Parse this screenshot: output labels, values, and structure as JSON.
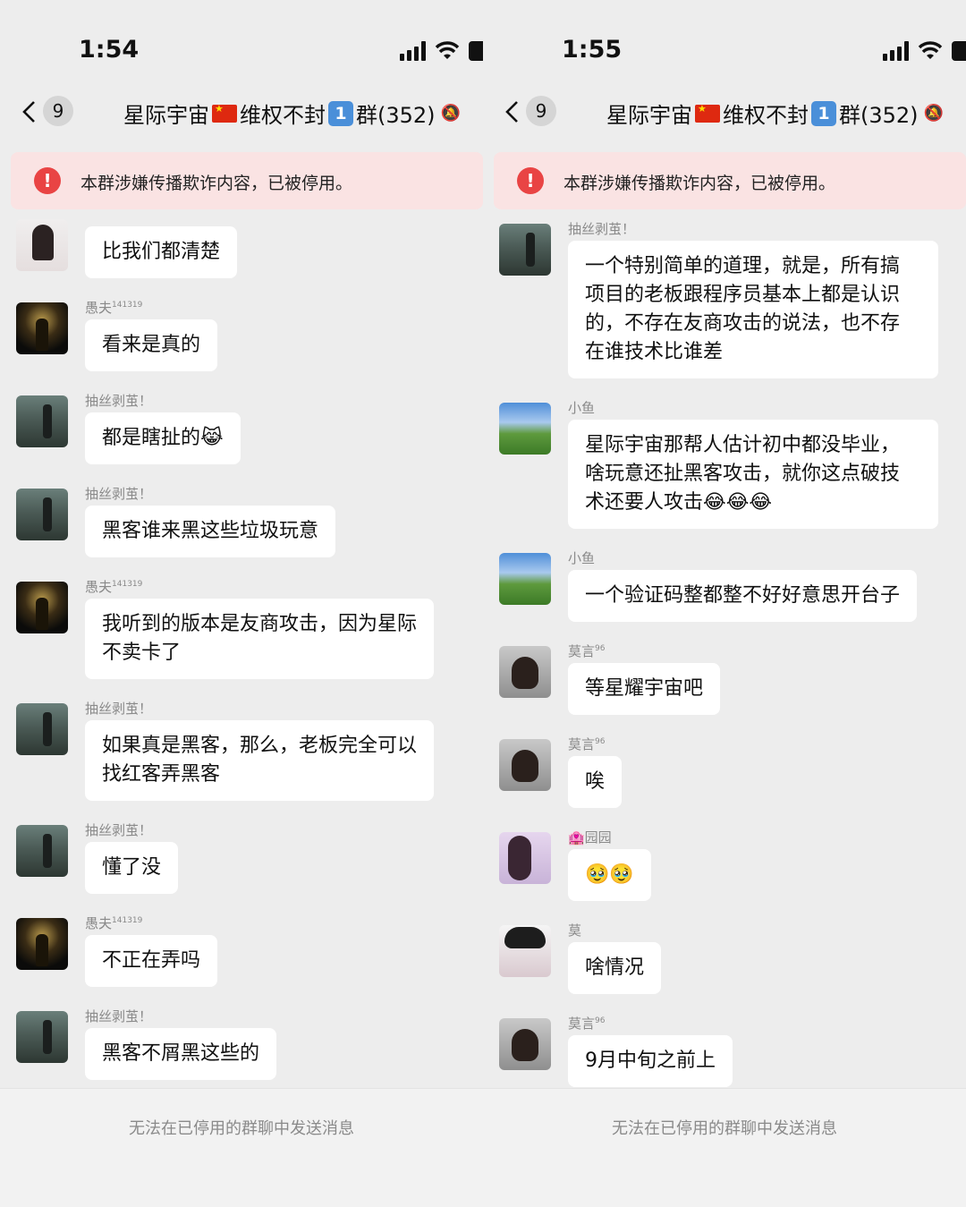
{
  "left": {
    "status_bar": {
      "time": "1:54"
    },
    "nav": {
      "back_icon": "chevron-left-icon",
      "unread_count": "9",
      "title_part1": "星际宇宙",
      "title_part2": "维权不封",
      "keycap": "1",
      "title_part3": "群(352)"
    },
    "alert": {
      "text": "本群涉嫌传播欺诈内容，已被停用。"
    },
    "messages": [
      {
        "sender": "",
        "text": "比我们都清楚"
      },
      {
        "sender": "愚夫",
        "sup": "141319",
        "text": "看来是真的"
      },
      {
        "sender": "抽丝剥茧！",
        "sup": "",
        "text": "都是瞎扯的"
      },
      {
        "sender": "抽丝剥茧！",
        "sup": "",
        "text": "黑客谁来黑这些垃圾玩意"
      },
      {
        "sender": "愚夫",
        "sup": "141319",
        "text_line1": "我听到的版本是友商攻击，因为星际",
        "text_line2": "不卖卡了"
      },
      {
        "sender": "抽丝剥茧！",
        "sup": "",
        "text_line1": "如果真是黑客，那么，老板完全可以",
        "text_line2": "找红客弄黑客"
      },
      {
        "sender": "抽丝剥茧！",
        "sup": "",
        "text": "懂了没"
      },
      {
        "sender": "愚夫",
        "sup": "141319",
        "text": "不正在弄吗"
      },
      {
        "sender": "抽丝剥茧！",
        "sup": "",
        "text": "黑客不屑黑这些的"
      }
    ],
    "footer": {
      "text": "无法在已停用的群聊中发送消息"
    }
  },
  "right": {
    "status_bar": {
      "time": "1:55"
    },
    "nav": {
      "back_icon": "chevron-left-icon",
      "unread_count": "9",
      "title_part1": "星际宇宙",
      "title_part2": "维权不封",
      "keycap": "1",
      "title_part3": "群(352)"
    },
    "alert": {
      "text": "本群涉嫌传播欺诈内容，已被停用。"
    },
    "messages": [
      {
        "sender": "抽丝剥茧！",
        "sup": "",
        "lines": [
          "一个特别简单的道理，就是，所有搞",
          "项目的老板跟程序员基本上都是认识",
          "的，不存在友商攻击的说法，也不存",
          "在谁技术比谁差"
        ]
      },
      {
        "sender": "小鱼",
        "sup": "",
        "lines": [
          "星际宇宙那帮人估计初中都没毕业，",
          "啥玩意还扯黑客攻击，就你这点破技",
          "术还要人攻击😂😂😂"
        ]
      },
      {
        "sender": "小鱼",
        "sup": "",
        "text": "一个验证码整都整不好好意思开台子"
      },
      {
        "sender": "莫言",
        "sup": "96",
        "text": "等星耀宇宙吧"
      },
      {
        "sender": "莫言",
        "sup": "96",
        "text": "唉"
      },
      {
        "sender": "🏩园园",
        "sup": "",
        "text": "🥹🥹"
      },
      {
        "sender": "莫",
        "sup": "",
        "text": "啥情况"
      },
      {
        "sender": "莫言",
        "sup": "96",
        "text": "9月中旬之前上"
      }
    ],
    "footer": {
      "text": "无法在已停用的群聊中发送消息"
    }
  }
}
